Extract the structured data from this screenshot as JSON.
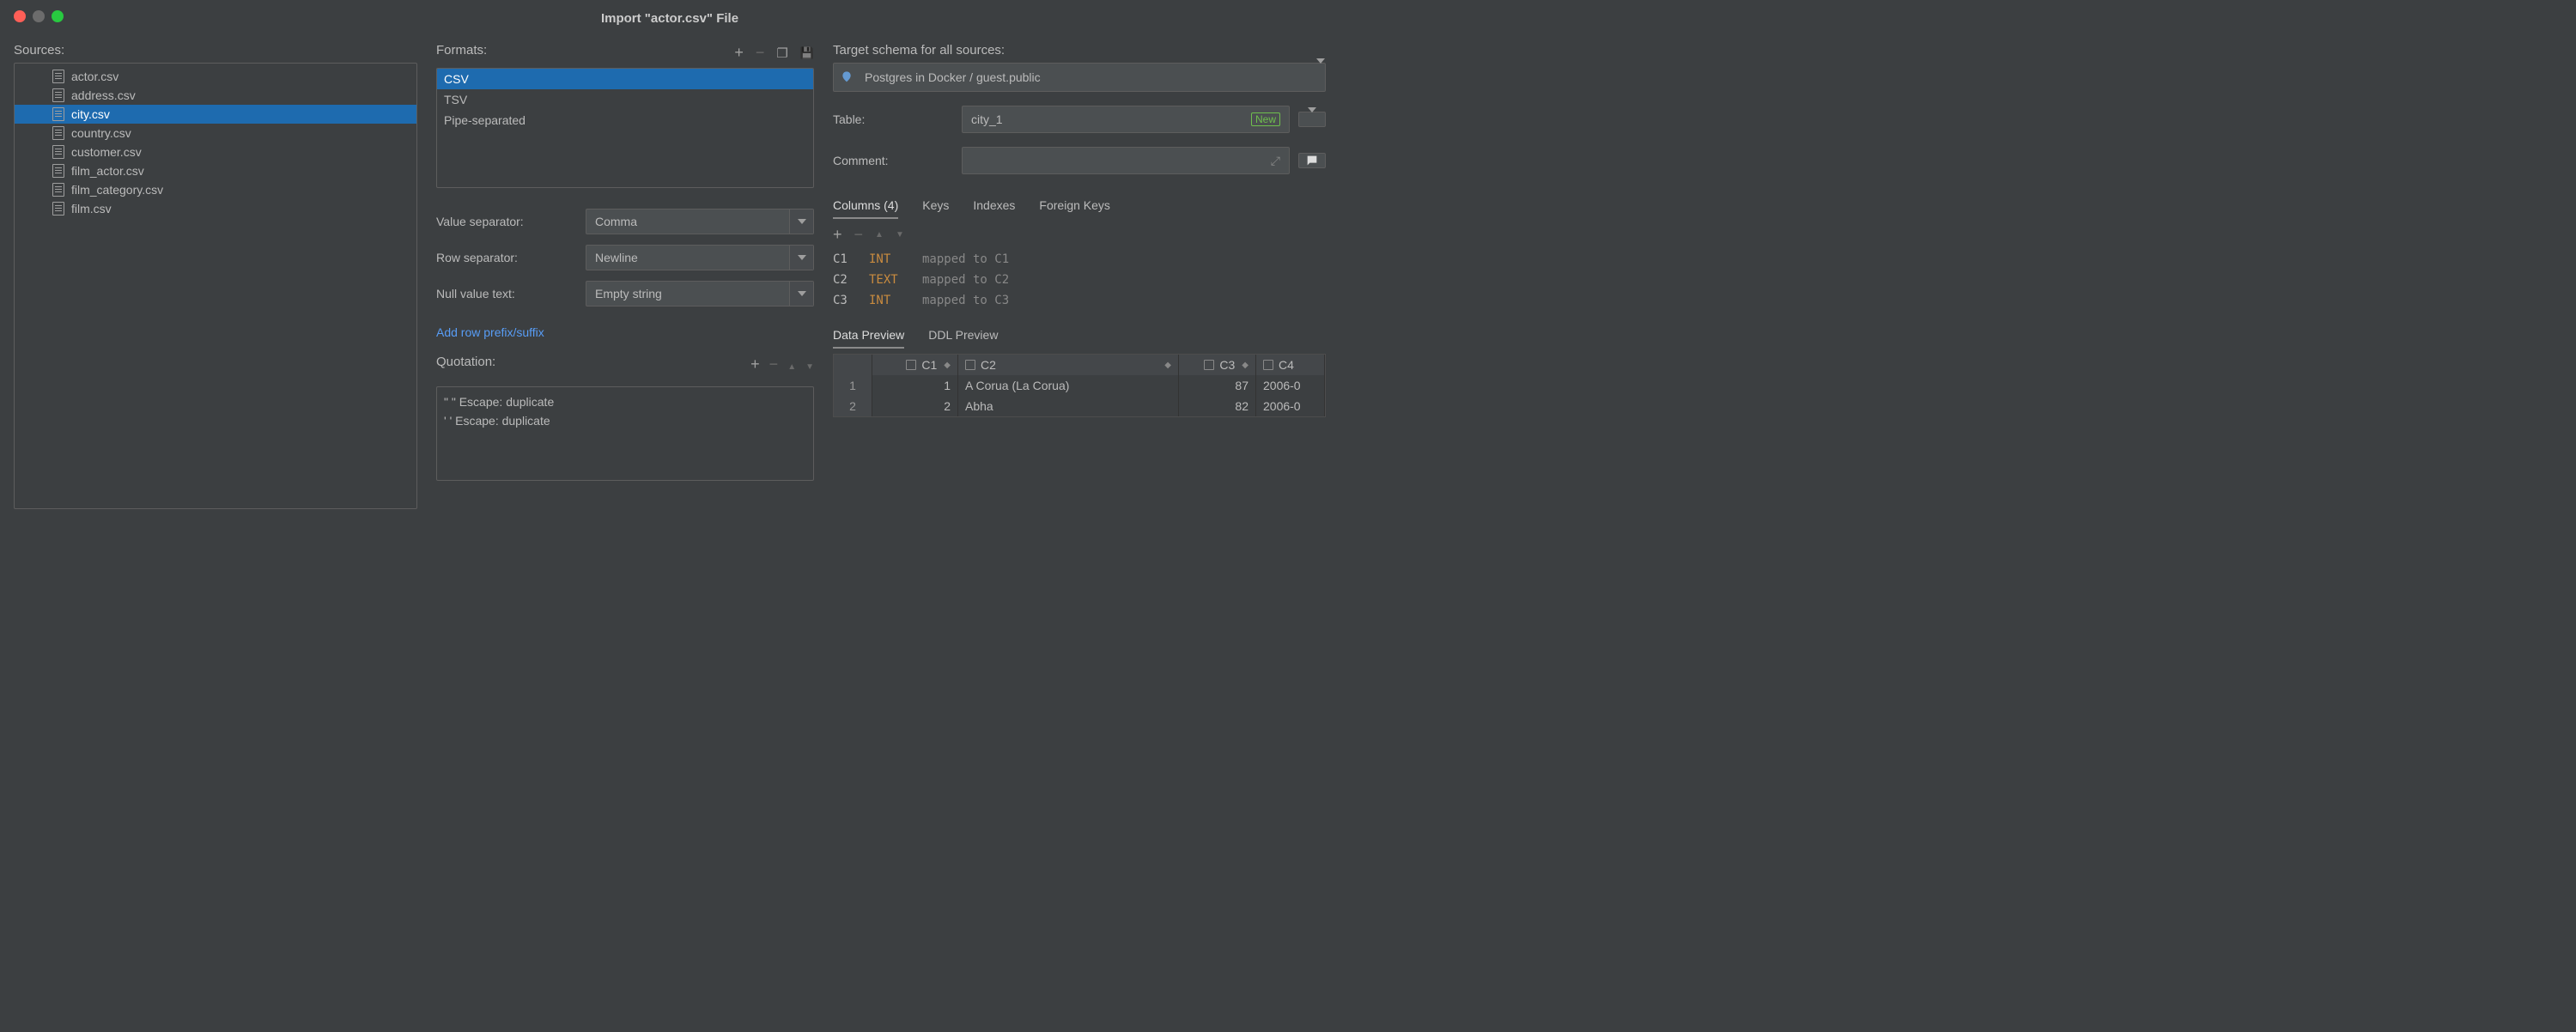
{
  "title": "Import \"actor.csv\" File",
  "sources": {
    "label": "Sources:",
    "items": [
      {
        "name": "actor.csv",
        "selected": false
      },
      {
        "name": "address.csv",
        "selected": false
      },
      {
        "name": "city.csv",
        "selected": true
      },
      {
        "name": "country.csv",
        "selected": false
      },
      {
        "name": "customer.csv",
        "selected": false
      },
      {
        "name": "film_actor.csv",
        "selected": false
      },
      {
        "name": "film_category.csv",
        "selected": false
      },
      {
        "name": "film.csv",
        "selected": false
      }
    ]
  },
  "formats": {
    "label": "Formats:",
    "items": [
      {
        "name": "CSV",
        "selected": true
      },
      {
        "name": "TSV",
        "selected": false
      },
      {
        "name": "Pipe-separated",
        "selected": false
      }
    ]
  },
  "valueSep": {
    "label": "Value separator:",
    "value": "Comma"
  },
  "rowSep": {
    "label": "Row separator:",
    "value": "Newline"
  },
  "nullText": {
    "label": "Null value text:",
    "value": "Empty string"
  },
  "addRowLink": "Add row prefix/suffix",
  "quotation": {
    "label": "Quotation:",
    "rows": [
      "\"  \"  Escape: duplicate",
      "'  '  Escape: duplicate"
    ]
  },
  "targetSchema": {
    "label": "Target schema for all sources:",
    "value": "Postgres in Docker / guest.public"
  },
  "table": {
    "label": "Table:",
    "value": "city_1",
    "badge": "New"
  },
  "comment": {
    "label": "Comment:",
    "value": ""
  },
  "colTabs": {
    "tabs": [
      "Columns (4)",
      "Keys",
      "Indexes",
      "Foreign Keys"
    ],
    "active": 0
  },
  "mappings": [
    {
      "col": "C1",
      "type": "INT",
      "text": "mapped to C1"
    },
    {
      "col": "C2",
      "type": "TEXT",
      "text": "mapped to C2"
    },
    {
      "col": "C3",
      "type": "INT",
      "text": "mapped to C3"
    }
  ],
  "preview": {
    "tabs": [
      "Data Preview",
      "DDL Preview"
    ],
    "active": 0,
    "headers": [
      "",
      "C1",
      "C2",
      "C3",
      "C4"
    ],
    "rows": [
      {
        "n": "1",
        "c1": "1",
        "c2": "A Corua (La Corua)",
        "c3": "87",
        "c4": "2006-0"
      },
      {
        "n": "2",
        "c1": "2",
        "c2": "Abha",
        "c3": "82",
        "c4": "2006-0"
      }
    ]
  }
}
